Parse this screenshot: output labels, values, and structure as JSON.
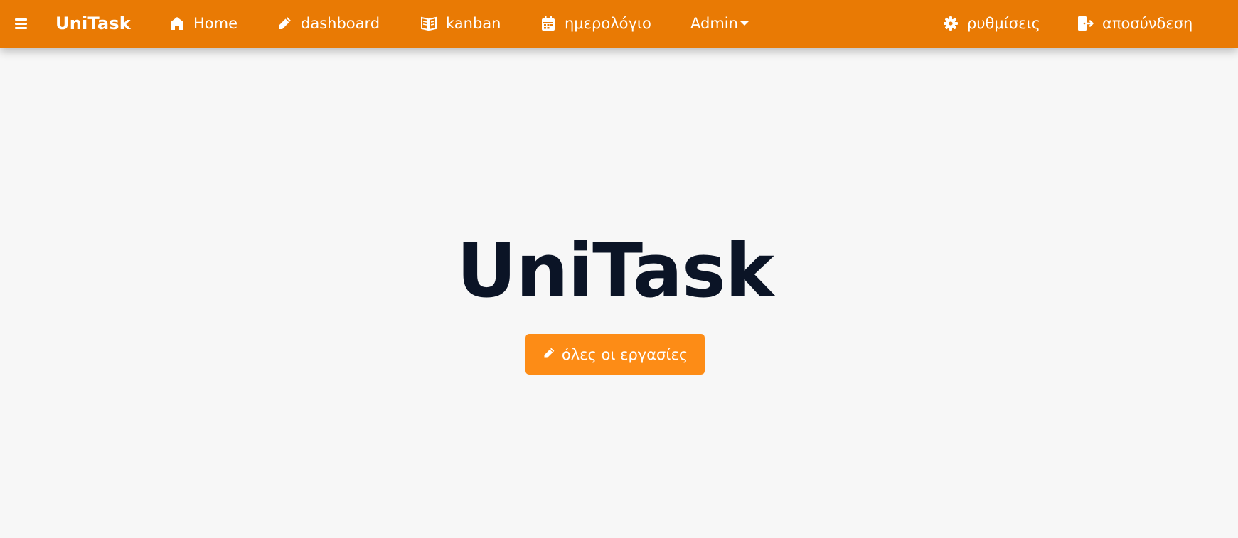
{
  "navbar": {
    "background": "#e97a04",
    "brand": "UniTask",
    "items": [
      {
        "label": "Home",
        "icon": "home-icon"
      },
      {
        "label": "dashboard",
        "icon": "pencil-icon"
      },
      {
        "label": "kanban",
        "icon": "book-open-icon"
      },
      {
        "label": "ημερολόγιο",
        "icon": "calendar-icon"
      },
      {
        "label": "Admin",
        "icon": "caret-down-icon"
      }
    ],
    "right_items": [
      {
        "label": "ρυθμίσεις",
        "icon": "gear-icon"
      },
      {
        "label": "αποσύνδεση",
        "icon": "sign-out-icon"
      }
    ],
    "menu_icon": "hamburger-menu-icon"
  },
  "hero": {
    "title": "UniTask",
    "title_color": "#0b1426",
    "button_label": "όλες οι εργασίες",
    "button_icon": "pencil-icon",
    "button_color": "#fd8c16"
  },
  "page_background": "#f7f7f7"
}
